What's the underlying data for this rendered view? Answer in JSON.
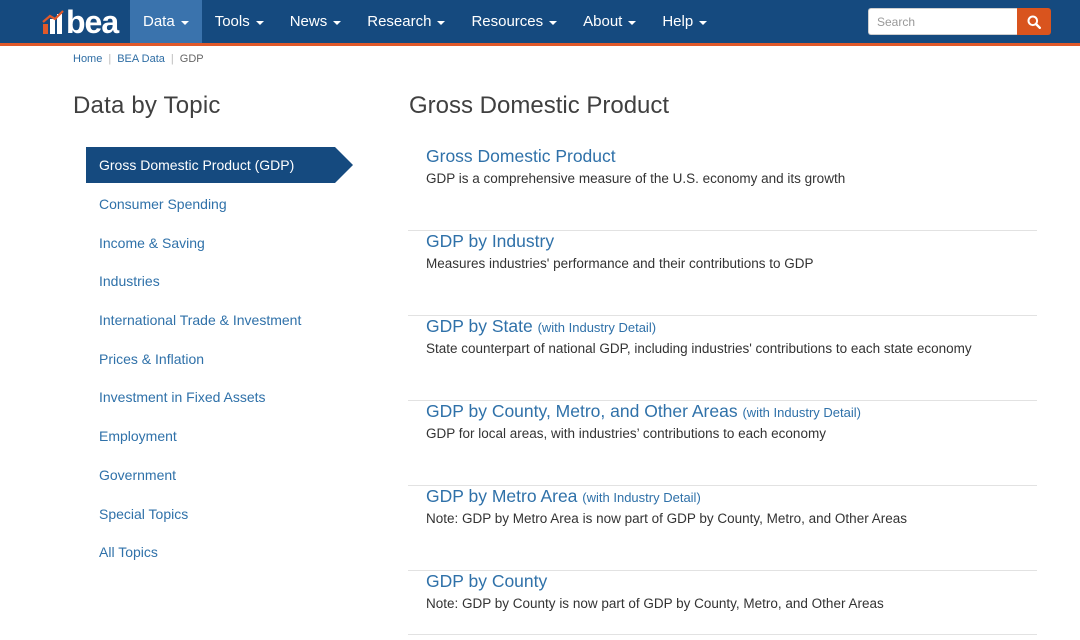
{
  "header": {
    "logo_text": "bea",
    "nav": [
      {
        "label": "Data",
        "active": true
      },
      {
        "label": "Tools",
        "active": false
      },
      {
        "label": "News",
        "active": false
      },
      {
        "label": "Research",
        "active": false
      },
      {
        "label": "Resources",
        "active": false
      },
      {
        "label": "About",
        "active": false
      },
      {
        "label": "Help",
        "active": false
      }
    ],
    "search": {
      "placeholder": "Search",
      "value": ""
    },
    "colors": {
      "nav_bg": "#154a7f",
      "accent": "#e0592a",
      "search_button": "#d9541e"
    }
  },
  "breadcrumb": {
    "items": [
      "Home",
      "BEA Data"
    ],
    "current": "GDP"
  },
  "sidebar": {
    "title": "Data by Topic",
    "active_item": "Gross Domestic Product (GDP)",
    "items": [
      "Consumer Spending",
      "Income & Saving",
      "Industries",
      "International Trade & Investment",
      "Prices & Inflation",
      "Investment in Fixed Assets",
      "Employment",
      "Government",
      "Special Topics",
      "All Topics"
    ]
  },
  "main": {
    "title": "Gross Domestic Product",
    "topics": [
      {
        "title": "Gross Domestic Product",
        "detail": "",
        "desc": "GDP is a comprehensive measure of the U.S. economy and its growth"
      },
      {
        "title": "GDP by Industry",
        "detail": "",
        "desc": "Measures industries' performance and their contributions to GDP"
      },
      {
        "title": "GDP by State",
        "detail": "(with Industry Detail)",
        "desc": "State counterpart of national GDP, including industries' contributions to each state economy"
      },
      {
        "title": "GDP by County, Metro, and Other Areas",
        "detail": "(with Industry Detail)",
        "desc": "GDP for local areas, with industries’ contributions to each economy"
      },
      {
        "title": "GDP by Metro Area",
        "detail": "(with Industry Detail)",
        "desc": "Note: GDP by Metro Area is now part of GDP by County, Metro, and Other Areas"
      },
      {
        "title": "GDP by County",
        "detail": "",
        "desc": "Note: GDP by County is now part of GDP by County, Metro, and Other Areas"
      }
    ]
  }
}
